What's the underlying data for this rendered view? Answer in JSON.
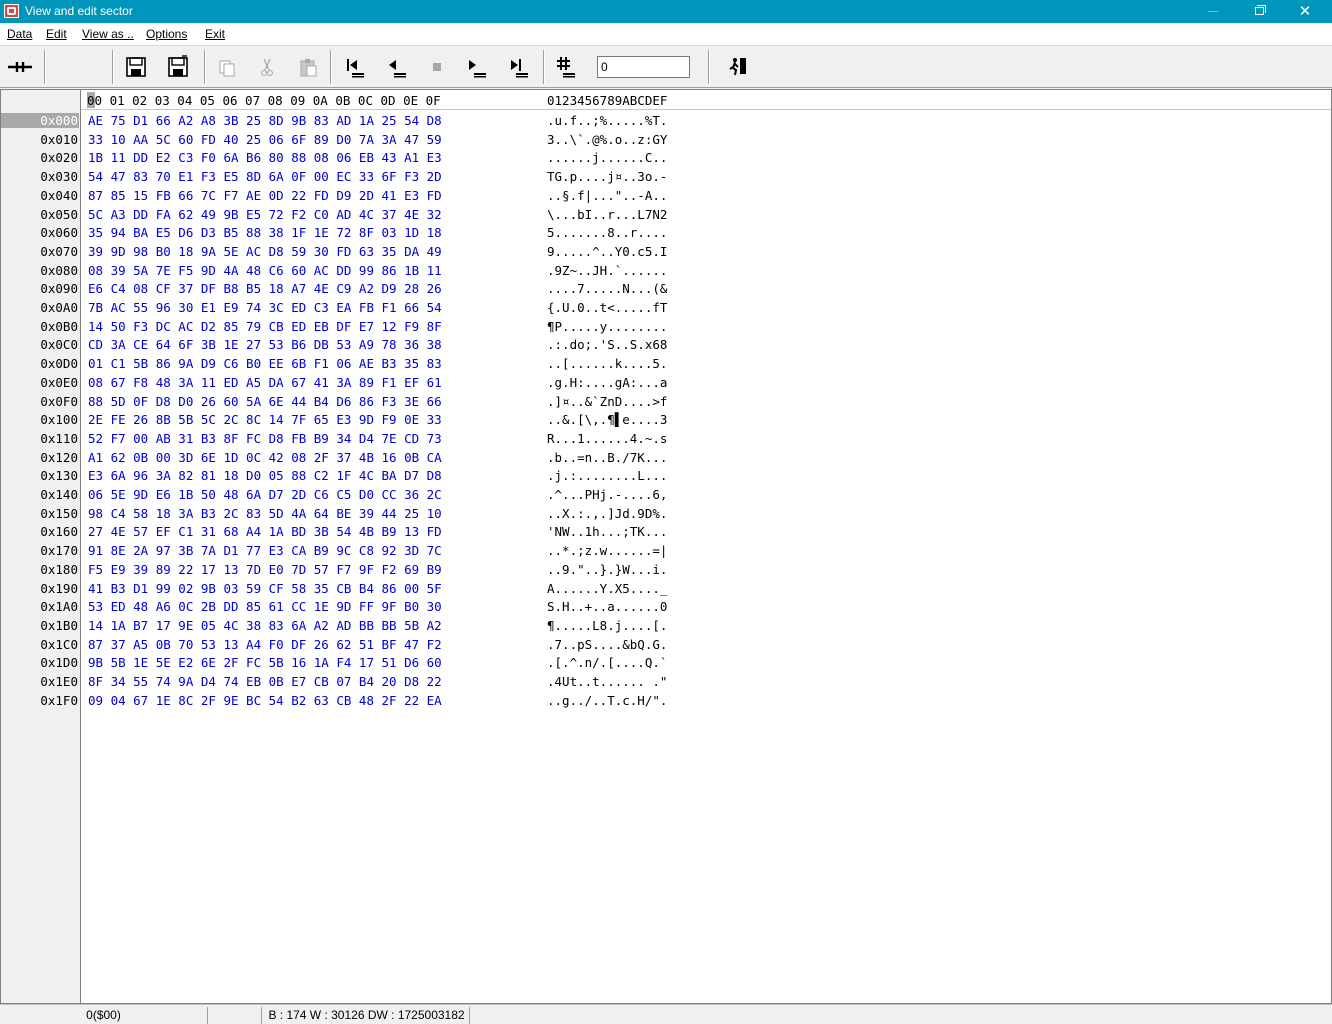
{
  "window": {
    "title": "View and edit sector"
  },
  "menu": [
    {
      "label": "Data"
    },
    {
      "label": "Edit"
    },
    {
      "label": "View as .."
    },
    {
      "label": "Options"
    },
    {
      "label": "Exit"
    }
  ],
  "toolbar": {
    "sector_value": "0"
  },
  "hex": {
    "header_cols": "00 01 02 03 04 05 06 07 08 09 0A 0B 0C 0D 0E 0F",
    "header_ascii": "0123456789ABCDEF",
    "rows": [
      {
        "addr": "0x000",
        "hex": "AE 75 D1 66 A2 A8 3B 25 8D 9B 83 AD 1A 25 54 D8",
        "ascii": ".u.f..;%.....%T."
      },
      {
        "addr": "0x010",
        "hex": "33 10 AA 5C 60 FD 40 25 06 6F 89 D0 7A 3A 47 59",
        "ascii": "3..\\`.@%.o..z:GY"
      },
      {
        "addr": "0x020",
        "hex": "1B 11 DD E2 C3 F0 6A B6 80 88 08 06 EB 43 A1 E3",
        "ascii": "......j......C.."
      },
      {
        "addr": "0x030",
        "hex": "54 47 83 70 E1 F3 E5 8D 6A 0F 00 EC 33 6F F3 2D",
        "ascii": "TG.p....j¤..3o.-"
      },
      {
        "addr": "0x040",
        "hex": "87 85 15 FB 66 7C F7 AE 0D 22 FD D9 2D 41 E3 FD",
        "ascii": "..§.f|...\"..-A.."
      },
      {
        "addr": "0x050",
        "hex": "5C A3 DD FA 62 49 9B E5 72 F2 C0 AD 4C 37 4E 32",
        "ascii": "\\...bI..r...L7N2"
      },
      {
        "addr": "0x060",
        "hex": "35 94 BA E5 D6 D3 B5 88 38 1F 1E 72 8F 03 1D 18",
        "ascii": "5.......8..r...."
      },
      {
        "addr": "0x070",
        "hex": "39 9D 98 B0 18 9A 5E AC D8 59 30 FD 63 35 DA 49",
        "ascii": "9.....^..Y0.c5.I"
      },
      {
        "addr": "0x080",
        "hex": "08 39 5A 7E F5 9D 4A 48 C6 60 AC DD 99 86 1B 11",
        "ascii": ".9Z~..JH.`......"
      },
      {
        "addr": "0x090",
        "hex": "E6 C4 08 CF 37 DF B8 B5 18 A7 4E C9 A2 D9 28 26",
        "ascii": "....7.....N...(&"
      },
      {
        "addr": "0x0A0",
        "hex": "7B AC 55 96 30 E1 E9 74 3C ED C3 EA FB F1 66 54",
        "ascii": "{.U.0..t<.....fT"
      },
      {
        "addr": "0x0B0",
        "hex": "14 50 F3 DC AC D2 85 79 CB ED EB DF E7 12 F9 8F",
        "ascii": "¶P.....y........"
      },
      {
        "addr": "0x0C0",
        "hex": "CD 3A CE 64 6F 3B 1E 27 53 B6 DB 53 A9 78 36 38",
        "ascii": ".:.do;.'S..S.x68"
      },
      {
        "addr": "0x0D0",
        "hex": "01 C1 5B 86 9A D9 C6 B0 EE 6B F1 06 AE B3 35 83",
        "ascii": "..[......k....5."
      },
      {
        "addr": "0x0E0",
        "hex": "08 67 F8 48 3A 11 ED A5 DA 67 41 3A 89 F1 EF 61",
        "ascii": ".g.H:....gA:...a"
      },
      {
        "addr": "0x0F0",
        "hex": "88 5D 0F D8 D0 26 60 5A 6E 44 B4 D6 86 F3 3E 66",
        "ascii": ".]¤..&`ZnD....>f"
      },
      {
        "addr": "0x100",
        "hex": "2E FE 26 8B 5B 5C 2C 8C 14 7F 65 E3 9D F9 0E 33",
        "ascii": "..&.[\\,.¶▌e....3"
      },
      {
        "addr": "0x110",
        "hex": "52 F7 00 AB 31 B3 8F FC D8 FB B9 34 D4 7E CD 73",
        "ascii": "R...1......4.~.s"
      },
      {
        "addr": "0x120",
        "hex": "A1 62 0B 00 3D 6E 1D 0C 42 08 2F 37 4B 16 0B CA",
        "ascii": ".b..=n..B./7K..."
      },
      {
        "addr": "0x130",
        "hex": "E3 6A 96 3A 82 81 18 D0 05 88 C2 1F 4C BA D7 D8",
        "ascii": ".j.:........L..."
      },
      {
        "addr": "0x140",
        "hex": "06 5E 9D E6 1B 50 48 6A D7 2D C6 C5 D0 CC 36 2C",
        "ascii": ".^...PHj.-....6,"
      },
      {
        "addr": "0x150",
        "hex": "98 C4 58 18 3A B3 2C 83 5D 4A 64 BE 39 44 25 10",
        "ascii": "..X.:.,.]Jd.9D%."
      },
      {
        "addr": "0x160",
        "hex": "27 4E 57 EF C1 31 68 A4 1A BD 3B 54 4B B9 13 FD",
        "ascii": "'NW..1h...;TK..."
      },
      {
        "addr": "0x170",
        "hex": "91 8E 2A 97 3B 7A D1 77 E3 CA B9 9C C8 92 3D 7C",
        "ascii": "..*.;z.w......=|"
      },
      {
        "addr": "0x180",
        "hex": "F5 E9 39 89 22 17 13 7D E0 7D 57 F7 9F F2 69 B9",
        "ascii": "..9.\"..}.}W...i."
      },
      {
        "addr": "0x190",
        "hex": "41 B3 D1 99 02 9B 03 59 CF 58 35 CB B4 86 00 5F",
        "ascii": "A......Y.X5...._"
      },
      {
        "addr": "0x1A0",
        "hex": "53 ED 48 A6 0C 2B DD 85 61 CC 1E 9D FF 9F B0 30",
        "ascii": "S.H..+..a......0"
      },
      {
        "addr": "0x1B0",
        "hex": "14 1A B7 17 9E 05 4C 38 83 6A A2 AD BB BB 5B A2",
        "ascii": "¶.....L8.j....[."
      },
      {
        "addr": "0x1C0",
        "hex": "87 37 A5 0B 70 53 13 A4 F0 DF 26 62 51 BF 47 F2",
        "ascii": ".7..pS....&bQ.G."
      },
      {
        "addr": "0x1D0",
        "hex": "9B 5B 1E 5E E2 6E 2F FC 5B 16 1A F4 17 51 D6 60",
        "ascii": ".[.^.n/.[....Q.`"
      },
      {
        "addr": "0x1E0",
        "hex": "8F 34 55 74 9A D4 74 EB 0B E7 CB 07 B4 20 D8 22",
        "ascii": ".4Ut..t...... .\""
      },
      {
        "addr": "0x1F0",
        "hex": "09 04 67 1E 8C 2F 9E BC 54 B2 63 CB 48 2F 22 EA",
        "ascii": "..g../..T.c.H/\"."
      }
    ]
  },
  "status": {
    "position": "0($00)",
    "middle": "",
    "values": "B : 174 W : 30126 DW : 1725003182"
  },
  "colors": {
    "titlebar": "#0096bc",
    "hex_text": "#0000cc",
    "selection": "#a9a9a9"
  },
  "icons": [
    "app-icon",
    "split-icon",
    "save-disk-icon",
    "save-as-disk-icon",
    "copy-icon",
    "cut-icon",
    "paste-icon",
    "first-sector-icon",
    "previous-sector-icon",
    "stop-icon",
    "next-sector-icon",
    "last-sector-icon",
    "goto-sector-icon",
    "exit-door-icon"
  ]
}
